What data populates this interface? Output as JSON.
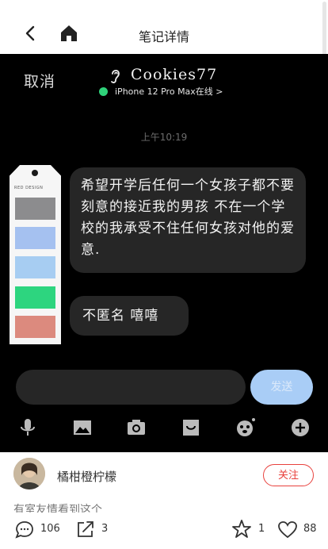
{
  "header": {
    "title": "笔记详情"
  },
  "chat": {
    "cancel_label": "取消",
    "contact_name": "Cookies77",
    "online_status": "iPhone 12 Pro Max在线 >",
    "time": "上午10:19",
    "messages": [
      "希望开学后任何一个女孩子都不要刻意的接近我的男孩 不在一个学校的我承受不住任何女孩对他的爱意.",
      "不匿名 嘻嘻"
    ],
    "send_label": "发送"
  },
  "tag": {
    "brand": "RED DESIGN",
    "swatches": [
      "#8c8c8e",
      "#a5c1f0",
      "#a7cdf2",
      "#2dd57f",
      "#dc8a7e"
    ]
  },
  "author": {
    "name": "橘柑橙柠檬",
    "follow_label": "关注"
  },
  "note_partial_text": "有室友情看到这个",
  "actions": {
    "comments": "106",
    "shares": "3",
    "collects": "1",
    "likes": "88"
  },
  "colors": {
    "accent": "#e8413d",
    "bubble": "#262626",
    "send": "#a9cdf6",
    "online": "#2fd27a"
  }
}
